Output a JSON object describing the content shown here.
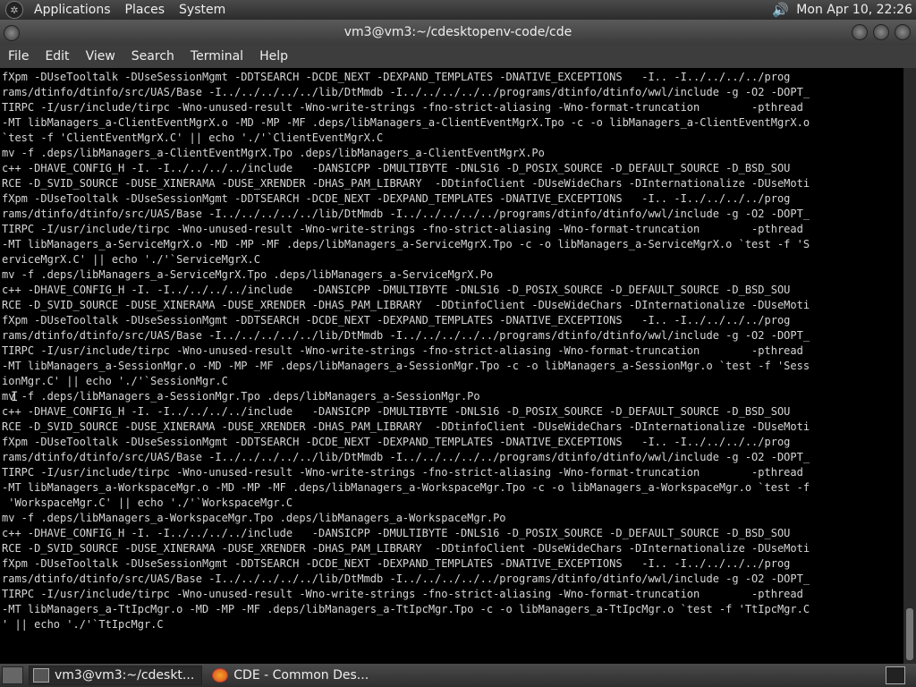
{
  "top_panel": {
    "applications": "Applications",
    "places": "Places",
    "system": "System",
    "clock": "Mon Apr 10, 22:26"
  },
  "window": {
    "title": "vm3@vm3:~/cdesktopenv-code/cde"
  },
  "menubar": {
    "file": "File",
    "edit": "Edit",
    "view": "View",
    "search": "Search",
    "terminal": "Terminal",
    "help": "Help"
  },
  "terminal_text": "fXpm -DUseTooltalk -DUseSessionMgmt -DDTSEARCH -DCDE_NEXT -DEXPAND_TEMPLATES -DNATIVE_EXCEPTIONS   -I.. -I../../../../prog\nrams/dtinfo/dtinfo/src/UAS/Base -I../../../../../lib/DtMmdb -I../../../../../programs/dtinfo/dtinfo/wwl/include -g -O2 -DOPT_\nTIRPC -I/usr/include/tirpc -Wno-unused-result -Wno-write-strings -fno-strict-aliasing -Wno-format-truncation        -pthread\n-MT libManagers_a-ClientEventMgrX.o -MD -MP -MF .deps/libManagers_a-ClientEventMgrX.Tpo -c -o libManagers_a-ClientEventMgrX.o\n`test -f 'ClientEventMgrX.C' || echo './'`ClientEventMgrX.C\nmv -f .deps/libManagers_a-ClientEventMgrX.Tpo .deps/libManagers_a-ClientEventMgrX.Po\nc++ -DHAVE_CONFIG_H -I. -I../../../../include   -DANSICPP -DMULTIBYTE -DNLS16 -D_POSIX_SOURCE -D_DEFAULT_SOURCE -D_BSD_SOU\nRCE -D_SVID_SOURCE -DUSE_XINERAMA -DUSE_XRENDER -DHAS_PAM_LIBRARY  -DDtinfoClient -DUseWideChars -DInternationalize -DUseMoti\nfXpm -DUseTooltalk -DUseSessionMgmt -DDTSEARCH -DCDE_NEXT -DEXPAND_TEMPLATES -DNATIVE_EXCEPTIONS   -I.. -I../../../../prog\nrams/dtinfo/dtinfo/src/UAS/Base -I../../../../../lib/DtMmdb -I../../../../../programs/dtinfo/dtinfo/wwl/include -g -O2 -DOPT_\nTIRPC -I/usr/include/tirpc -Wno-unused-result -Wno-write-strings -fno-strict-aliasing -Wno-format-truncation        -pthread\n-MT libManagers_a-ServiceMgrX.o -MD -MP -MF .deps/libManagers_a-ServiceMgrX.Tpo -c -o libManagers_a-ServiceMgrX.o `test -f 'S\nerviceMgrX.C' || echo './'`ServiceMgrX.C\nmv -f .deps/libManagers_a-ServiceMgrX.Tpo .deps/libManagers_a-ServiceMgrX.Po\nc++ -DHAVE_CONFIG_H -I. -I../../../../include   -DANSICPP -DMULTIBYTE -DNLS16 -D_POSIX_SOURCE -D_DEFAULT_SOURCE -D_BSD_SOU\nRCE -D_SVID_SOURCE -DUSE_XINERAMA -DUSE_XRENDER -DHAS_PAM_LIBRARY  -DDtinfoClient -DUseWideChars -DInternationalize -DUseMoti\nfXpm -DUseTooltalk -DUseSessionMgmt -DDTSEARCH -DCDE_NEXT -DEXPAND_TEMPLATES -DNATIVE_EXCEPTIONS   -I.. -I../../../../prog\nrams/dtinfo/dtinfo/src/UAS/Base -I../../../../../lib/DtMmdb -I../../../../../programs/dtinfo/dtinfo/wwl/include -g -O2 -DOPT_\nTIRPC -I/usr/include/tirpc -Wno-unused-result -Wno-write-strings -fno-strict-aliasing -Wno-format-truncation        -pthread\n-MT libManagers_a-SessionMgr.o -MD -MP -MF .deps/libManagers_a-SessionMgr.Tpo -c -o libManagers_a-SessionMgr.o `test -f 'Sess\nionMgr.C' || echo './'`SessionMgr.C\nmv -f .deps/libManagers_a-SessionMgr.Tpo .deps/libManagers_a-SessionMgr.Po\nc++ -DHAVE_CONFIG_H -I. -I../../../../include   -DANSICPP -DMULTIBYTE -DNLS16 -D_POSIX_SOURCE -D_DEFAULT_SOURCE -D_BSD_SOU\nRCE -D_SVID_SOURCE -DUSE_XINERAMA -DUSE_XRENDER -DHAS_PAM_LIBRARY  -DDtinfoClient -DUseWideChars -DInternationalize -DUseMoti\nfXpm -DUseTooltalk -DUseSessionMgmt -DDTSEARCH -DCDE_NEXT -DEXPAND_TEMPLATES -DNATIVE_EXCEPTIONS   -I.. -I../../../../prog\nrams/dtinfo/dtinfo/src/UAS/Base -I../../../../../lib/DtMmdb -I../../../../../programs/dtinfo/dtinfo/wwl/include -g -O2 -DOPT_\nTIRPC -I/usr/include/tirpc -Wno-unused-result -Wno-write-strings -fno-strict-aliasing -Wno-format-truncation        -pthread\n-MT libManagers_a-WorkspaceMgr.o -MD -MP -MF .deps/libManagers_a-WorkspaceMgr.Tpo -c -o libManagers_a-WorkspaceMgr.o `test -f\n 'WorkspaceMgr.C' || echo './'`WorkspaceMgr.C\nmv -f .deps/libManagers_a-WorkspaceMgr.Tpo .deps/libManagers_a-WorkspaceMgr.Po\nc++ -DHAVE_CONFIG_H -I. -I../../../../include   -DANSICPP -DMULTIBYTE -DNLS16 -D_POSIX_SOURCE -D_DEFAULT_SOURCE -D_BSD_SOU\nRCE -D_SVID_SOURCE -DUSE_XINERAMA -DUSE_XRENDER -DHAS_PAM_LIBRARY  -DDtinfoClient -DUseWideChars -DInternationalize -DUseMoti\nfXpm -DUseTooltalk -DUseSessionMgmt -DDTSEARCH -DCDE_NEXT -DEXPAND_TEMPLATES -DNATIVE_EXCEPTIONS   -I.. -I../../../../prog\nrams/dtinfo/dtinfo/src/UAS/Base -I../../../../../lib/DtMmdb -I../../../../../programs/dtinfo/dtinfo/wwl/include -g -O2 -DOPT_\nTIRPC -I/usr/include/tirpc -Wno-unused-result -Wno-write-strings -fno-strict-aliasing -Wno-format-truncation        -pthread\n-MT libManagers_a-TtIpcMgr.o -MD -MP -MF .deps/libManagers_a-TtIpcMgr.Tpo -c -o libManagers_a-TtIpcMgr.o `test -f 'TtIpcMgr.C\n' || echo './'`TtIpcMgr.C",
  "taskbar": {
    "task_terminal": "vm3@vm3:~/cdeskt...",
    "task_browser": "CDE - Common Des..."
  },
  "icons": {
    "logo": "gnome-foot-icon",
    "volume": "speaker-icon",
    "terminal_task": "terminal-icon",
    "browser_task": "firefox-icon",
    "tray": "terminal-tray-icon"
  }
}
